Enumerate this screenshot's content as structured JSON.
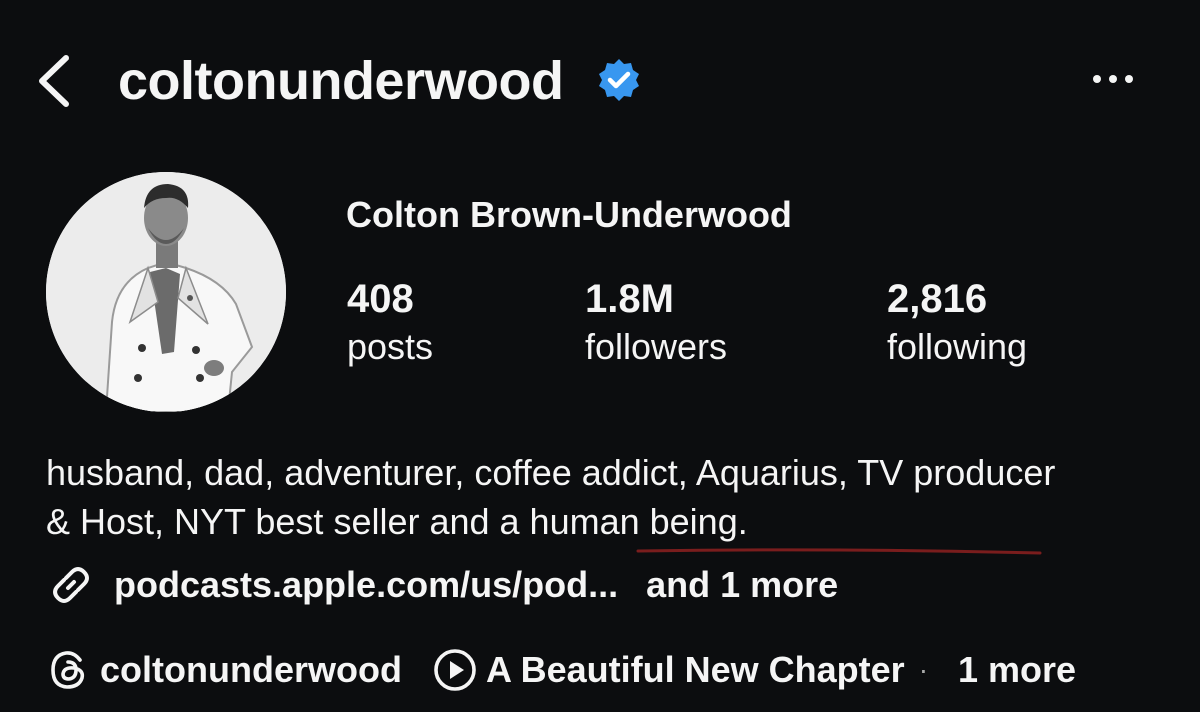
{
  "header": {
    "username": "coltonunderwood",
    "verified_color": "#3897f0",
    "back_icon": "chevron-left-icon",
    "more_icon": "more-horizontal-icon"
  },
  "profile": {
    "full_name": "Colton Brown-Underwood",
    "avatar_icon": "profile-photo"
  },
  "stats": {
    "posts": {
      "value": "408",
      "label": "posts"
    },
    "followers": {
      "value": "1.8M",
      "label": "followers"
    },
    "following": {
      "value": "2,816",
      "label": "following"
    }
  },
  "bio": {
    "text": "husband, dad, adventurer, coffee addict, Aquarius, TV producer & Host, NYT best seller and a human being.",
    "underline_color": "#7a1d1d"
  },
  "links": {
    "icon": "link-icon",
    "url": "podcasts.apple.com/us/pod...",
    "more": "and 1 more"
  },
  "bottom": {
    "threads_icon": "threads-icon",
    "threads_name": "coltonunderwood",
    "play_icon": "play-circle-icon",
    "chapter": "A Beautiful New Chapter",
    "separator": "·",
    "more": "1 more"
  }
}
